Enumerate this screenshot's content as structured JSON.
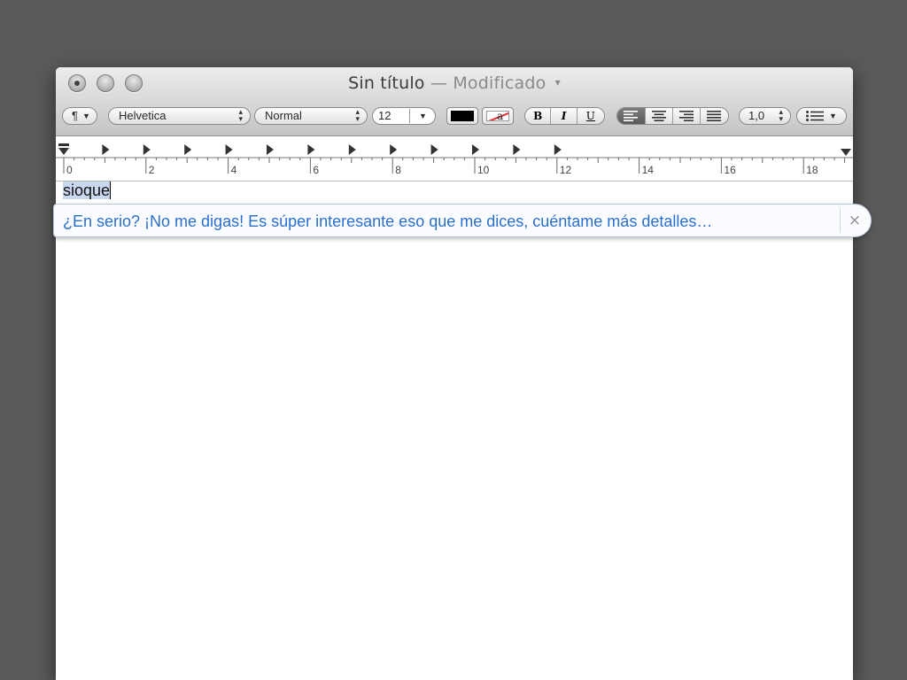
{
  "window": {
    "title": "Sin título",
    "status": "— Modificado",
    "title_caret": "▾"
  },
  "toolbar": {
    "paragraph_menu": "¶",
    "font_family": "Helvetica",
    "font_style": "Normal",
    "font_size": "12",
    "text_color": "#000000",
    "highlight_label": "a",
    "bold": "B",
    "italic": "I",
    "underline": "U",
    "alignment_selected": "left",
    "line_spacing": "1,0",
    "list_icon": "list-icon"
  },
  "ruler": {
    "labels": [
      "0",
      "2",
      "4",
      "6",
      "8",
      "10",
      "12",
      "14",
      "16",
      "18"
    ]
  },
  "document": {
    "text": "sioque"
  },
  "autocorrect": {
    "suggestion": "¿En serio? ¡No me digas! Es súper interesante eso que me dices, cuéntame más detalles…",
    "close": "×"
  }
}
